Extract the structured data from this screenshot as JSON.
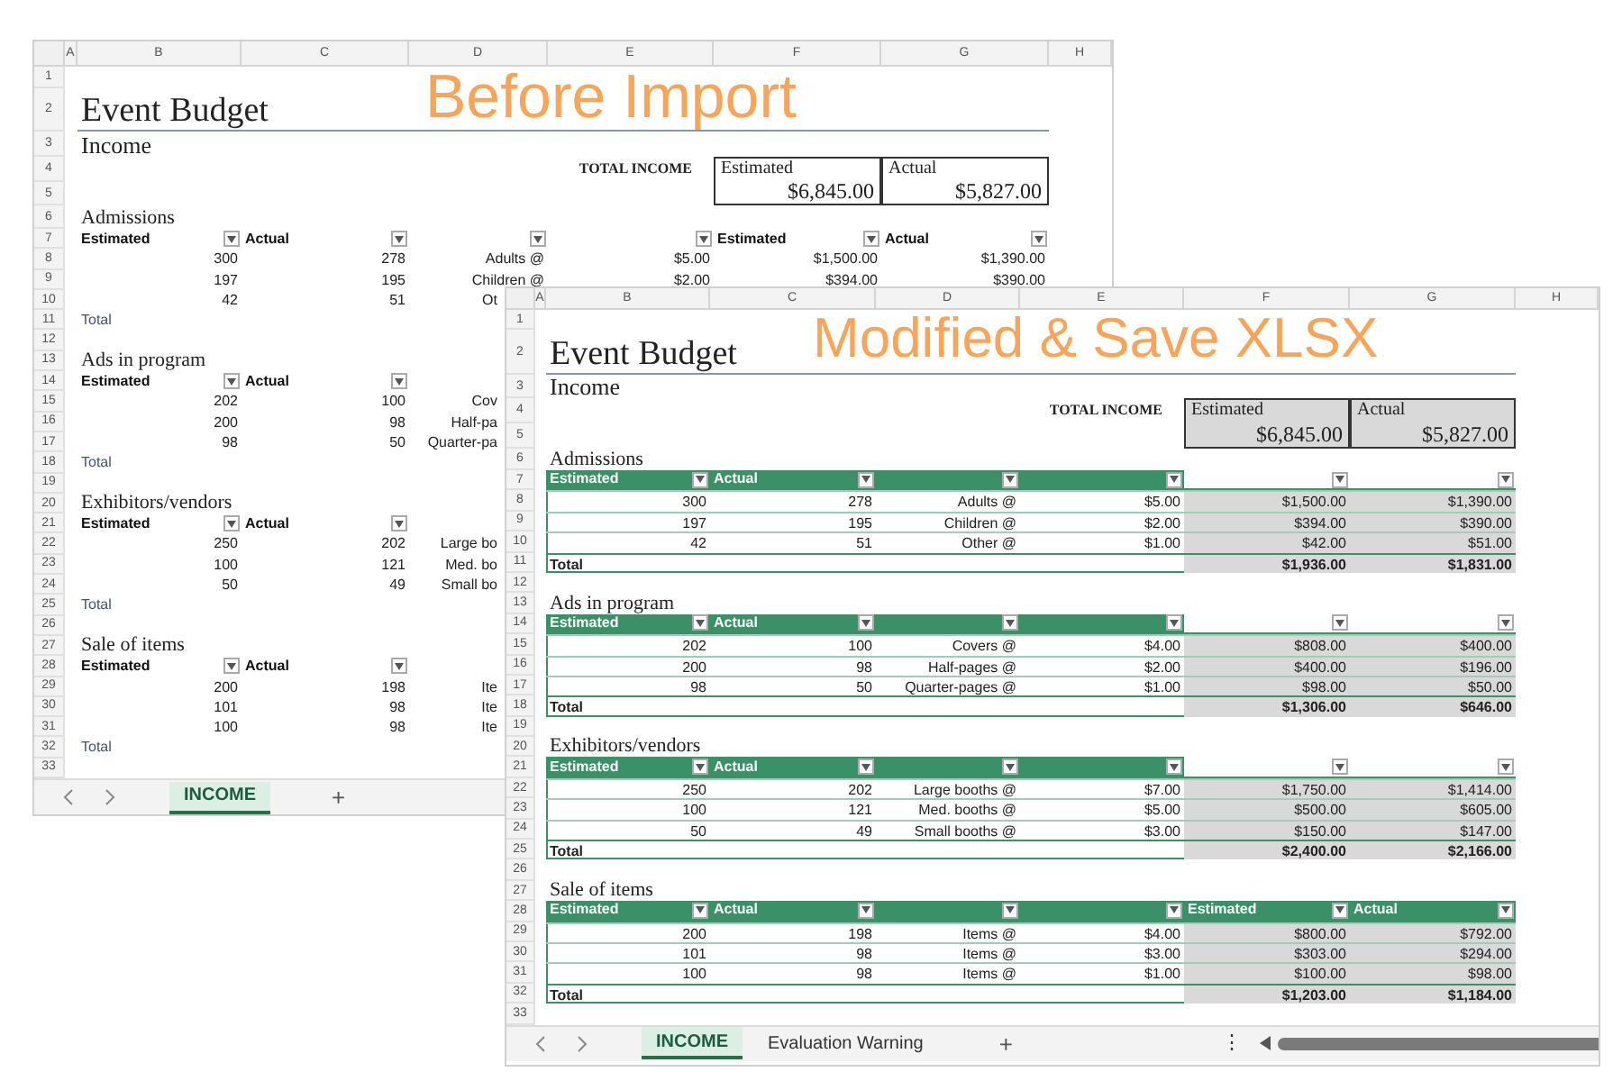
{
  "sheets": [
    {
      "caption": "Before Import",
      "styled": false,
      "column_headers": [
        "A",
        "B",
        "C",
        "D",
        "E",
        "F",
        "G",
        "H"
      ],
      "row_numbers": [
        "1",
        "2",
        "3",
        "4",
        "5",
        "6",
        "7",
        "8",
        "9",
        "10",
        "11",
        "12",
        "13",
        "14",
        "15",
        "16",
        "17",
        "18",
        "19",
        "20",
        "21",
        "22",
        "23",
        "24",
        "25",
        "26",
        "27",
        "28",
        "29",
        "30",
        "31",
        "32",
        "33"
      ],
      "title": "Event Budget",
      "subtitle": "Income",
      "total_income": {
        "label": "TOTAL INCOME",
        "estimated_label": "Estimated",
        "estimated": "$6,845.00",
        "actual_label": "Actual",
        "actual": "$5,827.00"
      },
      "sections": [
        {
          "title": "Admissions",
          "headers": [
            {
              "label": "Estimated",
              "highlighted": false
            },
            {
              "label": "Actual",
              "highlighted": false
            },
            {
              "highlighted": false
            },
            {
              "highlighted": false
            },
            {
              "label": "Estimated",
              "highlighted": false
            },
            {
              "label": "Actual",
              "highlighted": false
            }
          ],
          "rows": [
            {
              "cells": [
                "300",
                "278",
                "Adults @",
                "$5.00",
                "$1,500.00",
                "$1,390.00"
              ]
            },
            {
              "cells": [
                "197",
                "195",
                "Children @",
                "$2.00",
                "$394.00",
                "$390.00"
              ]
            },
            {
              "cells": [
                "42",
                "51",
                "Ot"
              ]
            }
          ],
          "total": {
            "label": "Total"
          }
        },
        {
          "title": "Ads in program",
          "headers": [
            {
              "label": "Estimated",
              "highlighted": false
            },
            {
              "label": "Actual",
              "highlighted": false
            }
          ],
          "rows": [
            {
              "cells": [
                "202",
                "100",
                "Cov"
              ]
            },
            {
              "cells": [
                "200",
                "98",
                "Half-pa"
              ]
            },
            {
              "cells": [
                "98",
                "50",
                "Quarter-pa"
              ]
            }
          ],
          "total": {
            "label": "Total"
          }
        },
        {
          "title": "Exhibitors/vendors",
          "headers": [
            {
              "label": "Estimated",
              "highlighted": false
            },
            {
              "label": "Actual",
              "highlighted": false
            }
          ],
          "rows": [
            {
              "cells": [
                "250",
                "202",
                "Large bo"
              ]
            },
            {
              "cells": [
                "100",
                "121",
                "Med. bo"
              ]
            },
            {
              "cells": [
                "50",
                "49",
                "Small bo"
              ]
            }
          ],
          "total": {
            "label": "Total"
          }
        },
        {
          "title": "Sale of items",
          "headers": [
            {
              "label": "Estimated",
              "highlighted": false
            },
            {
              "label": "Actual",
              "highlighted": false
            }
          ],
          "rows": [
            {
              "cells": [
                "200",
                "198",
                "Ite"
              ]
            },
            {
              "cells": [
                "101",
                "98",
                "Ite"
              ]
            },
            {
              "cells": [
                "100",
                "98",
                "Ite"
              ]
            }
          ],
          "total": {
            "label": "Total"
          }
        }
      ],
      "tabs": [
        {
          "label": "INCOME",
          "selected": true
        }
      ],
      "add_tab": "+"
    },
    {
      "caption": "Modified & Save XLSX",
      "styled": true,
      "column_headers": [
        "A",
        "B",
        "C",
        "D",
        "E",
        "F",
        "G",
        "H"
      ],
      "row_numbers": [
        "1",
        "2",
        "3",
        "4",
        "5",
        "6",
        "7",
        "8",
        "9",
        "10",
        "11",
        "12",
        "13",
        "14",
        "15",
        "16",
        "17",
        "18",
        "19",
        "20",
        "21",
        "22",
        "23",
        "24",
        "25",
        "26",
        "27",
        "28",
        "29",
        "30",
        "31",
        "32",
        "33"
      ],
      "title": "Event Budget",
      "subtitle": "Income",
      "total_income": {
        "label": "TOTAL INCOME",
        "estimated_label": "Estimated",
        "estimated": "$6,845.00",
        "actual_label": "Actual",
        "actual": "$5,827.00"
      },
      "sections": [
        {
          "title": "Admissions",
          "headers": [
            {
              "label": "Estimated",
              "highlighted": true
            },
            {
              "label": "Actual",
              "highlighted": true
            },
            {
              "highlighted": true
            },
            {
              "highlighted": true
            },
            {
              "highlighted": false
            },
            {
              "highlighted": false
            }
          ],
          "rows": [
            {
              "cells": [
                "300",
                "278",
                "Adults @",
                "$5.00",
                "$1,500.00",
                "$1,390.00"
              ]
            },
            {
              "cells": [
                "197",
                "195",
                "Children @",
                "$2.00",
                "$394.00",
                "$390.00"
              ]
            },
            {
              "cells": [
                "42",
                "51",
                "Other @",
                "$1.00",
                "$42.00",
                "$51.00"
              ]
            }
          ],
          "total": {
            "label": "Total",
            "estimated": "$1,936.00",
            "actual": "$1,831.00"
          }
        },
        {
          "title": "Ads in program",
          "headers": [
            {
              "label": "Estimated",
              "highlighted": true
            },
            {
              "label": "Actual",
              "highlighted": true
            },
            {
              "highlighted": true
            },
            {
              "highlighted": true
            },
            {
              "highlighted": false
            },
            {
              "highlighted": false
            }
          ],
          "rows": [
            {
              "cells": [
                "202",
                "100",
                "Covers @",
                "$4.00",
                "$808.00",
                "$400.00"
              ]
            },
            {
              "cells": [
                "200",
                "98",
                "Half-pages @",
                "$2.00",
                "$400.00",
                "$196.00"
              ]
            },
            {
              "cells": [
                "98",
                "50",
                "Quarter-pages @",
                "$1.00",
                "$98.00",
                "$50.00"
              ]
            }
          ],
          "total": {
            "label": "Total",
            "estimated": "$1,306.00",
            "actual": "$646.00"
          }
        },
        {
          "title": "Exhibitors/vendors",
          "headers": [
            {
              "label": "Estimated",
              "highlighted": true
            },
            {
              "label": "Actual",
              "highlighted": true
            },
            {
              "highlighted": true
            },
            {
              "highlighted": true
            },
            {
              "highlighted": false
            },
            {
              "highlighted": false
            }
          ],
          "rows": [
            {
              "cells": [
                "250",
                "202",
                "Large booths @",
                "$7.00",
                "$1,750.00",
                "$1,414.00"
              ]
            },
            {
              "cells": [
                "100",
                "121",
                "Med. booths @",
                "$5.00",
                "$500.00",
                "$605.00"
              ]
            },
            {
              "cells": [
                "50",
                "49",
                "Small booths @",
                "$3.00",
                "$150.00",
                "$147.00"
              ]
            }
          ],
          "total": {
            "label": "Total",
            "estimated": "$2,400.00",
            "actual": "$2,166.00"
          }
        },
        {
          "title": "Sale of items",
          "headers": [
            {
              "label": "Estimated",
              "highlighted": true
            },
            {
              "label": "Actual",
              "highlighted": true
            },
            {
              "highlighted": true
            },
            {
              "highlighted": true
            },
            {
              "label": "Estimated",
              "highlighted": true
            },
            {
              "label": "Actual",
              "highlighted": true
            }
          ],
          "rows": [
            {
              "cells": [
                "200",
                "198",
                "Items @",
                "$4.00",
                "$800.00",
                "$792.00"
              ]
            },
            {
              "cells": [
                "101",
                "98",
                "Items @",
                "$3.00",
                "$303.00",
                "$294.00"
              ]
            },
            {
              "cells": [
                "100",
                "98",
                "Items @",
                "$1.00",
                "$100.00",
                "$98.00"
              ]
            }
          ],
          "total": {
            "label": "Total",
            "estimated": "$1,203.00",
            "actual": "$1,184.00"
          }
        }
      ],
      "tabs": [
        {
          "label": "INCOME",
          "selected": true
        },
        {
          "label": "Evaluation Warning",
          "selected": false
        }
      ],
      "add_tab": "+",
      "tab_bar_menu": "⋮"
    }
  ]
}
